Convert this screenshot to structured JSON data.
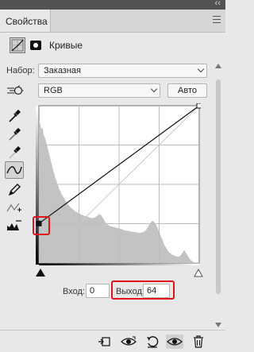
{
  "panel": {
    "tab_label": "Свойства",
    "title": "Кривые",
    "collapse_glyph": "‹‹"
  },
  "preset": {
    "label": "Набор:",
    "value": "Заказная"
  },
  "channel": {
    "value": "RGB",
    "auto_label": "Авто"
  },
  "io": {
    "input_label": "Вход:",
    "input_value": "0",
    "output_label": "Выход:",
    "output_value": "64"
  },
  "curve": {
    "points": [
      [
        0,
        64
      ],
      [
        255,
        255
      ]
    ],
    "selected_point": [
      0,
      64
    ]
  },
  "histogram": [
    250,
    248,
    245,
    238,
    236,
    240,
    232,
    225,
    222,
    220,
    215,
    210,
    205,
    200,
    196,
    190,
    186,
    180,
    175,
    170,
    166,
    160,
    158,
    152,
    148,
    146,
    140,
    138,
    135,
    130,
    128,
    126,
    122,
    120,
    118,
    116,
    114,
    112,
    110,
    108,
    106,
    104,
    103,
    101,
    100,
    98,
    97,
    96,
    95,
    94,
    93,
    92,
    91,
    90,
    90,
    89,
    88,
    88,
    87,
    86,
    86,
    85,
    85,
    84,
    84,
    83,
    83,
    82,
    82,
    82,
    81,
    81,
    80,
    80,
    80,
    79,
    79,
    79,
    80,
    80,
    80,
    81,
    82,
    83,
    84,
    85,
    86,
    86,
    85,
    84,
    82,
    80,
    78,
    76,
    74,
    72,
    70,
    69,
    68,
    67,
    66,
    66,
    65,
    65,
    64,
    64,
    64,
    63,
    63,
    63,
    62,
    62,
    62,
    61,
    61,
    61,
    60,
    60,
    60,
    59,
    59,
    58,
    58,
    58,
    57,
    57,
    57,
    57,
    56,
    56,
    56,
    56,
    55,
    55,
    55,
    55,
    55,
    54,
    54,
    54,
    54,
    54,
    53,
    53,
    53,
    53,
    53,
    54,
    54,
    55,
    55,
    56,
    57,
    58,
    60,
    62,
    64,
    66,
    68,
    70,
    72,
    73,
    74,
    74,
    73,
    72,
    70,
    68,
    66,
    63,
    60,
    57,
    54,
    51,
    48,
    45,
    42,
    39,
    36,
    33,
    30,
    28,
    26,
    24,
    22,
    20,
    19,
    18,
    17,
    16,
    15,
    14,
    14,
    13,
    13,
    12,
    12,
    11,
    11,
    11,
    11,
    12,
    13,
    14,
    16,
    18,
    20,
    22,
    22,
    20,
    18,
    16,
    14,
    12,
    10,
    8,
    6,
    5,
    4,
    3,
    2,
    2,
    1,
    1,
    1,
    1,
    1,
    1,
    1,
    1
  ],
  "colors": {
    "highlight": "#e0141a",
    "histogram": "#c3c3c3",
    "curve": "#111111"
  },
  "icons": {
    "tools": [
      "target-adjust-icon",
      "black-point-eyedropper-icon",
      "gray-point-eyedropper-icon",
      "white-point-eyedropper-icon",
      "curve-points-icon",
      "pencil-draw-icon",
      "smooth-curve-icon",
      "clipping-warning-icon"
    ],
    "bottom": [
      "clip-to-layer-icon",
      "view-previous-state-icon",
      "reset-icon",
      "toggle-visibility-icon",
      "delete-icon"
    ]
  }
}
